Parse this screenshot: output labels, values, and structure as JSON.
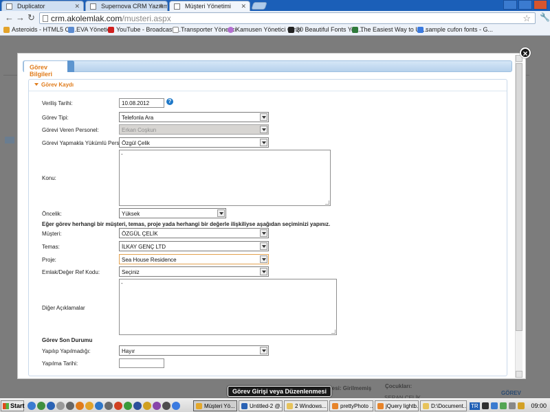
{
  "browser": {
    "tabs": [
      {
        "label": "Duplicator"
      },
      {
        "label": "Supernova CRM Yazılımı"
      },
      {
        "label": "Müşteri Yönetimi"
      }
    ],
    "url_domain": "crm.akolemlak.com",
    "url_path": "/musteri.aspx",
    "bookmarks": [
      {
        "label": "Asteroids - HTML5 Ca...",
        "color": "#e3a32b"
      },
      {
        "label": "EVA Yönetici",
        "color": "#5b8bd0"
      },
      {
        "label": "YouTube - Broadcast ...",
        "color": "#d01f1f"
      },
      {
        "label": "Transporter Yönetici",
        "color": "#ffffff"
      },
      {
        "label": "Kamusen Yönetici Girişi",
        "color": "#b46fd1"
      },
      {
        "label": "20 Beautiful Fonts You...",
        "color": "#222222"
      },
      {
        "label": "The Easiest Way to Us...",
        "color": "#2f7a3b"
      },
      {
        "label": "sample cufon fonts - G...",
        "color": "#3a7ae0"
      }
    ]
  },
  "modal": {
    "tab_label": "Görev Bilgileri",
    "section_title": "Görev Kaydı",
    "fields": {
      "verilis_tarihi": {
        "label": "Veriliş Tarihi:",
        "value": "10.08.2012"
      },
      "gorev_tipi": {
        "label": "Görev Tipi:",
        "value": "Telefonla Ara"
      },
      "gorevi_veren": {
        "label": "Görevi Veren Personel:",
        "value": "Erkan Coşkun"
      },
      "gorevi_yapmakla": {
        "label": "Görevi Yapmakla Yükümlü Personel:",
        "value": "Özgül Çelik"
      },
      "konu": {
        "label": "Konu:",
        "value": "-"
      },
      "oncelik": {
        "label": "Öncelik:",
        "value": "Yüksek"
      },
      "iliski_note": "Eğer görev herhangi bir müşteri, temas, proje yada herhangi bir değerle ilişkiliyse aşağıdan seçiminizi yapınız.",
      "musteri": {
        "label": "Müşteri:",
        "value": "ÖZGÜL ÇELİK"
      },
      "temas": {
        "label": "Temas:",
        "value": "İLKAY GENÇ LTD"
      },
      "proje": {
        "label": "Proje:",
        "value": "Sea House Residence"
      },
      "emlak_ref": {
        "label": "Emlak/Değer Ref Kodu:",
        "value": "Seçiniz"
      },
      "diger": {
        "label": "Diğer Açıklamalar",
        "value": "-"
      },
      "son_durum_title": "Görev Son Durumu",
      "yapilip": {
        "label": "Yapılıp Yapılmadığı:",
        "value": "Hayır"
      },
      "yapilma_tarihi": {
        "label": "Yapılma Tarihi:",
        "value": ""
      }
    },
    "close_symbol": "×"
  },
  "lightbox_title": "Görev Girişi veya Düzenlenmesi",
  "background": {
    "footer_text_1": "Adresi: Girilmemiş",
    "footer_text_2": "Çocukları:",
    "footer_text_3": "GÖREV",
    "footer_text_4": "SERAN ÇELİK"
  },
  "taskbar": {
    "start": "Start",
    "tasks": [
      {
        "label": "Müşteri Yö...",
        "color": "#e4a82a"
      },
      {
        "label": "Untitled-2 @...",
        "color": "#2a62b4"
      },
      {
        "label": "2 Windows...",
        "color": "#e7c35b"
      },
      {
        "label": "prettyPhoto ...",
        "color": "#e7842a"
      },
      {
        "label": "jQuery lightb...",
        "color": "#e7842a"
      },
      {
        "label": "D:\\Document...",
        "color": "#e7c35b"
      }
    ],
    "lang": "TR",
    "clock": "09:00"
  }
}
